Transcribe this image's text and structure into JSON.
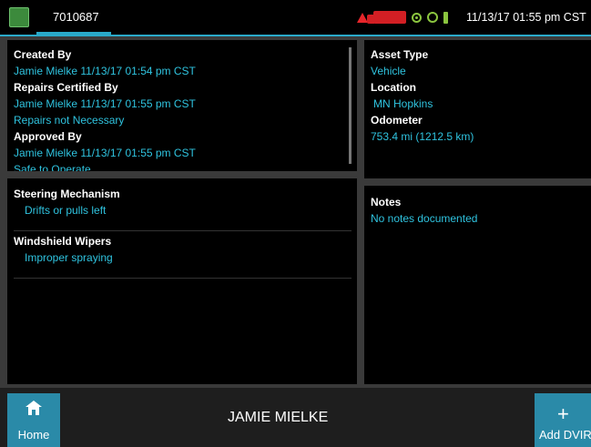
{
  "header": {
    "tab_label": "7010687",
    "datetime": "11/13/17 01:55 pm CST",
    "status_icons": [
      "warning-icon",
      "truck-icon",
      "gps-icon",
      "signal-icon",
      "power-plug-icon"
    ],
    "colors": {
      "accent": "#2aa9c9",
      "value_text": "#2fc3df",
      "alert": "#e8262b",
      "status_ok": "#8bc53f"
    }
  },
  "summary": {
    "created_by_label": "Created By",
    "created_by_value": "Jamie Mielke 11/13/17 01:54 pm CST",
    "repairs_certified_label": "Repairs Certified By",
    "repairs_certified_value": "Jamie Mielke 11/13/17 01:55 pm CST",
    "repairs_status": "Repairs not Necessary",
    "approved_by_label": "Approved By",
    "approved_by_value": "Jamie Mielke 11/13/17 01:55 pm CST",
    "safety_status": "Safe to Operate"
  },
  "asset": {
    "type_label": "Asset Type",
    "type_value": "Vehicle",
    "location_label": "Location",
    "location_value": "MN Hopkins",
    "odometer_label": "Odometer",
    "odometer_value": "753.4 mi (1212.5 km)"
  },
  "defects": [
    {
      "category": "Steering Mechanism",
      "detail": "Drifts or pulls left"
    },
    {
      "category": "Windshield Wipers",
      "detail": "Improper spraying"
    }
  ],
  "notes": {
    "label": "Notes",
    "value": "No notes documented"
  },
  "footer": {
    "home_label": "Home",
    "driver_name": "JAMIE MIELKE",
    "add_label": "Add DVIR",
    "add_glyph": "+"
  }
}
